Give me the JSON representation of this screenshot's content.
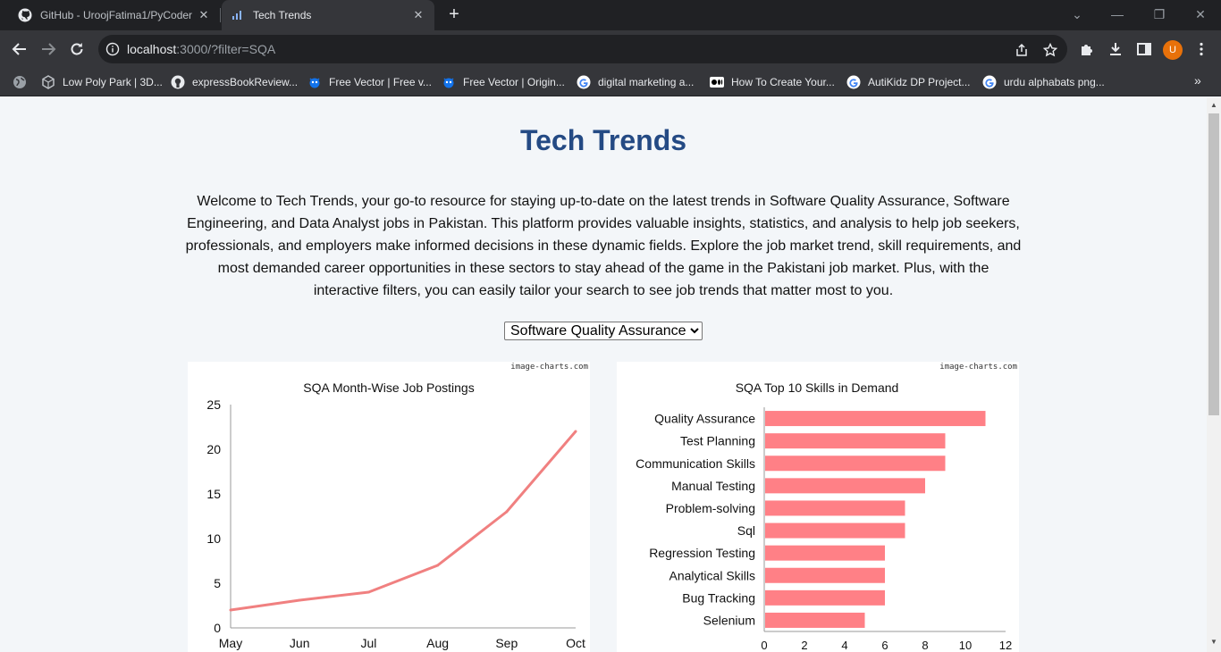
{
  "browser": {
    "tabs": [
      {
        "title": "GitHub - UroojFatima1/PyCoder",
        "icon": "github-icon"
      },
      {
        "title": "Tech Trends",
        "icon": "bar-chart-icon"
      }
    ],
    "url_host": "localhost",
    "url_rest": ":3000/?filter=SQA",
    "avatar_letter": "U",
    "bookmarks": [
      {
        "label": "Low Poly Park | 3D...",
        "icon": "unity-icon"
      },
      {
        "label": "expressBookReview...",
        "icon": "github-icon"
      },
      {
        "label": "Free Vector | Free v...",
        "icon": "freepik-icon"
      },
      {
        "label": "Free Vector | Origin...",
        "icon": "freepik-icon"
      },
      {
        "label": "digital marketing a...",
        "icon": "google-icon"
      },
      {
        "label": "How To Create Your...",
        "icon": "medium-icon"
      },
      {
        "label": "AutiKidz DP Project...",
        "icon": "google-icon"
      },
      {
        "label": "urdu alphabats png...",
        "icon": "google-icon"
      }
    ]
  },
  "page": {
    "title": "Tech Trends",
    "intro": "Welcome to Tech Trends, your go-to resource for staying up-to-date on the latest trends in Software Quality Assurance, Software Engineering, and Data Analyst jobs in Pakistan. This platform provides valuable insights, statistics, and analysis to help job seekers, professionals, and employers make informed decisions in these dynamic fields. Explore the job market trend, skill requirements, and most demanded career opportunities in these sectors to stay ahead of the game in the Pakistani job market. Plus, with the interactive filters, you can easily tailor your search to see job trends that matter most to you.",
    "filter_selected": "Software Quality Assurance",
    "brand_label": "image-charts.com"
  },
  "chart_data": [
    {
      "type": "line",
      "title": "SQA Month-Wise Job Postings",
      "categories": [
        "May",
        "Jun",
        "Jul",
        "Aug",
        "Sep",
        "Oct"
      ],
      "values": [
        2,
        3.1,
        4,
        7,
        13,
        22
      ],
      "ylim": [
        0,
        25
      ],
      "yticks": [
        0,
        5,
        10,
        15,
        20,
        25
      ],
      "color": "#f08080"
    },
    {
      "type": "bar",
      "orientation": "horizontal",
      "title": "SQA Top 10 Skills in Demand",
      "categories": [
        "Quality Assurance",
        "Test Planning",
        "Communication Skills",
        "Manual Testing",
        "Problem-solving",
        "Sql",
        "Regression Testing",
        "Analytical Skills",
        "Bug Tracking",
        "Selenium"
      ],
      "values": [
        11,
        9,
        9,
        8,
        7,
        7,
        6,
        6,
        6,
        5
      ],
      "xlim": [
        0,
        12
      ],
      "xticks": [
        0,
        2,
        4,
        6,
        8,
        10,
        12
      ],
      "color": "#ff8086"
    }
  ]
}
